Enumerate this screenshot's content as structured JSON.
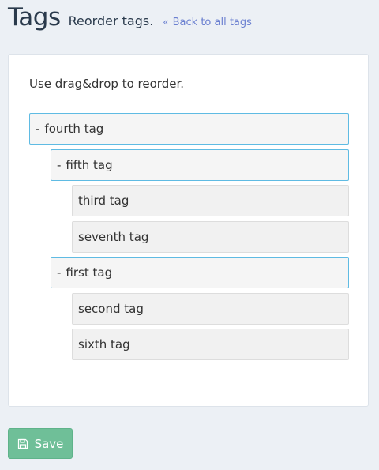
{
  "header": {
    "title": "Tags",
    "subtitle": "Reorder tags.",
    "back_link": {
      "icon": "double-chevron-left-icon",
      "label": "Back to all tags"
    }
  },
  "panel": {
    "instruction": "Use drag&drop to reorder.",
    "tree": [
      {
        "label": "fourth tag",
        "toggle": "-",
        "children": [
          {
            "label": "fifth tag",
            "toggle": "-",
            "children": [
              {
                "label": "third tag"
              },
              {
                "label": "seventh tag"
              }
            ]
          },
          {
            "label": "first tag",
            "toggle": "-",
            "children": [
              {
                "label": "second tag"
              },
              {
                "label": "sixth tag"
              }
            ]
          }
        ]
      }
    ]
  },
  "actions": {
    "save_label": "Save",
    "save_icon": "floppy-disk-icon"
  },
  "colors": {
    "page_background": "#ecf0f5",
    "parent_border": "#5fbbe3",
    "save_button": "#6fbf98",
    "link": "#6a7fd0"
  }
}
